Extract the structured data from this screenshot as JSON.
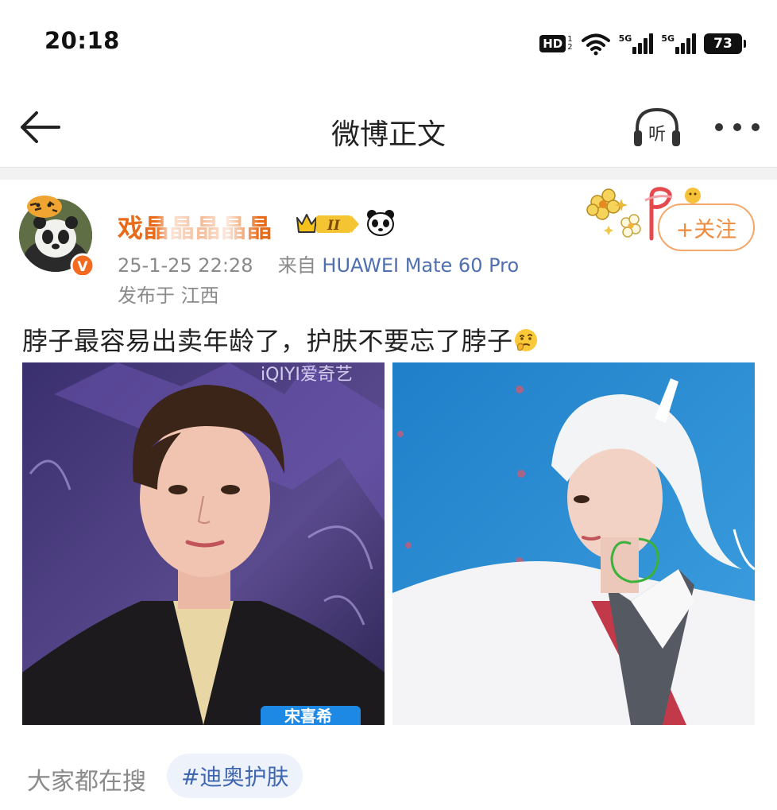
{
  "status_bar": {
    "time": "20:18",
    "hd_label": "HD",
    "hd_sub_top": "1",
    "hd_sub_bottom": "2",
    "signal_1_label": "5G",
    "signal_2_label": "5G",
    "battery_level": "73",
    "icons": [
      "hd-voice-icon",
      "wifi-icon",
      "signal-5g-icon",
      "signal-5g-icon",
      "battery-icon"
    ]
  },
  "nav": {
    "title": "微博正文",
    "back_icon": "arrow-left-icon",
    "listen_label": "听",
    "listen_icon": "headphones-icon",
    "more_icon": "more-dots-icon"
  },
  "post": {
    "author": {
      "name": "戏晶晶晶晶晶",
      "verified_icon": "verified-v-icon",
      "vip_level": "II",
      "vip_icon": "crown-icon",
      "extra_icon": "panda-icon"
    },
    "time": "25-1-25 22:28",
    "source_prefix": "来自",
    "source_device": "HUAWEI Mate 60 Pro",
    "location": "发布于 江西",
    "follow_label": "+关注",
    "text": "脖子最容易出卖年龄了，护肤不要忘了脖子",
    "text_emoji": "thinking-emoji-icon",
    "images": [
      {
        "name": "photo-1",
        "watermark": "iQIYI爱奇艺",
        "caption": "宋喜希"
      },
      {
        "name": "photo-2"
      }
    ]
  },
  "footer": {
    "search_label": "大家都在搜",
    "hashtag": "#迪奥护肤"
  },
  "colors": {
    "username": "#e86b1a",
    "device_link": "#4f6fae",
    "follow_border": "#f5a76a",
    "follow_text": "#f08a3c",
    "hashtag_bg": "#eef3fb",
    "hashtag_text": "#3f67b1"
  }
}
